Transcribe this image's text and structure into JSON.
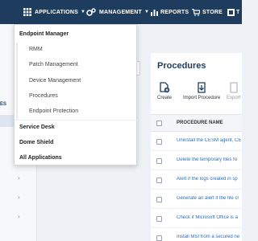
{
  "topnav": {
    "applications": "APPLICATIONS",
    "management": "MANAGEMENT",
    "reports": "REPORTS",
    "store": "STORE",
    "partial": "T"
  },
  "sidebar": {
    "partial_label": "ES"
  },
  "dropdown": {
    "endpoint_manager": "Endpoint Manager",
    "subitems": [
      "RMM",
      "Patch Management",
      "Device Management",
      "Procedures",
      "Endpoint Protection"
    ],
    "service_desk": "Service Desk",
    "dome_shield": "Dome Shield",
    "all_applications": "All Applications"
  },
  "main": {
    "title": "Procedures",
    "toolbar": {
      "create": "Create",
      "import": "Import Procedure",
      "export": "Export"
    },
    "table": {
      "column": "PROCEDURE NAME",
      "rows": [
        "Uninstall the CESM agent, CE",
        "Delete the temporary files fo",
        "Alert if the logs created in sp",
        "Generate an alert if the file cr",
        "Check if Microsoft Office is a",
        "Install MSI from a secured ne"
      ]
    }
  },
  "colors": {
    "nav_bg": "#1e3d5e",
    "link": "#2a6ebb",
    "panel_title": "#1e3d5e"
  }
}
